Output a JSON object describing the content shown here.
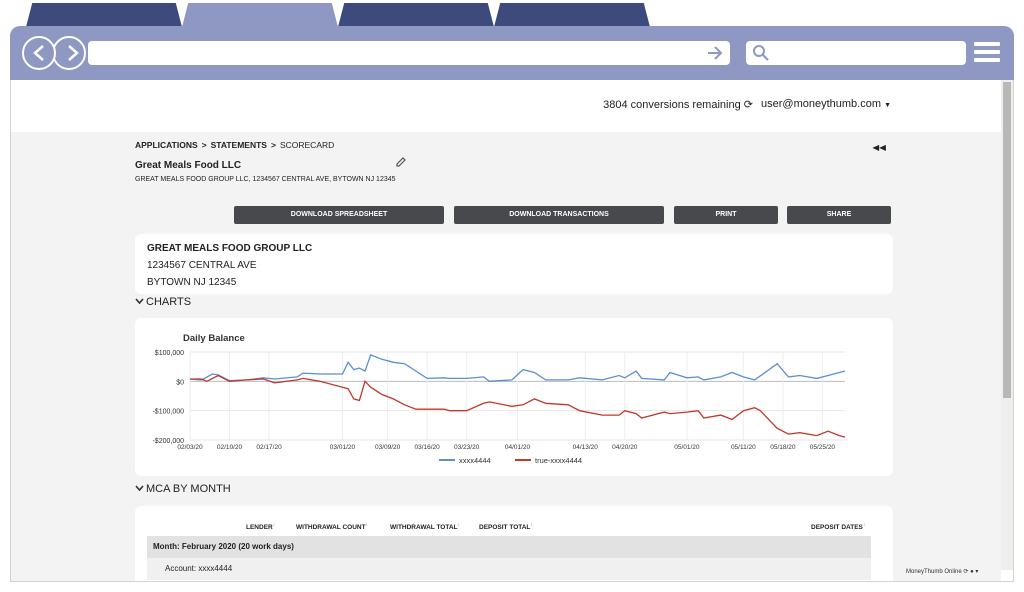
{
  "topbar": {
    "conversions": "3804 conversions remaining",
    "user": "user@moneythumb.com"
  },
  "breadcrumb": {
    "applications": "APPLICATIONS",
    "statements": "STATEMENTS",
    "scorecard": "SCORECARD"
  },
  "company": {
    "name": "Great Meals Food LLC",
    "subtitle": "GREAT MEALS FOOD GROUP LLC, 1234567 CENTRAL AVE, BYTOWN NJ 12345"
  },
  "buttons": {
    "download_spreadsheet": "DOWNLOAD SPREADSHEET",
    "download_transactions": "DOWNLOAD TRANSACTIONS",
    "print": "PRINT",
    "share": "SHARE"
  },
  "address": {
    "line1": "GREAT MEALS FOOD GROUP LLC",
    "line2": "1234567 CENTRAL AVE",
    "line3": "BYTOWN NJ 12345"
  },
  "sections": {
    "charts": "CHARTS",
    "mca": "MCA BY MONTH"
  },
  "chart_data": {
    "type": "line",
    "title": "Daily Balance",
    "xlabel": "",
    "ylabel": "",
    "ylim": [
      -200000,
      100000
    ],
    "yticks": [
      {
        "value": 100000,
        "label": "$100,000"
      },
      {
        "value": 0,
        "label": "$0"
      },
      {
        "value": -100000,
        "label": "-$100,000"
      },
      {
        "value": -200000,
        "label": "-$200,000"
      }
    ],
    "xticks": [
      "02/03/20",
      "02/10/20",
      "02/17/20",
      "03/01/20",
      "03/09/20",
      "03/16/20",
      "03/23/20",
      "04/01/20",
      "04/13/20",
      "04/20/20",
      "05/01/20",
      "05/11/20",
      "05/18/20",
      "05/25/20"
    ],
    "xtick_days": [
      0,
      7,
      14,
      27,
      35,
      42,
      49,
      58,
      70,
      77,
      88,
      98,
      105,
      112
    ],
    "xlim_days": [
      0,
      116
    ],
    "grid": true,
    "legend": "bottom",
    "series": [
      {
        "name": "xxxx4444",
        "color": "#5b8fd0",
        "days": [
          0,
          2,
          4,
          5,
          7,
          10,
          13,
          15,
          19,
          20,
          23,
          27,
          28,
          29,
          30,
          31,
          32,
          34,
          36,
          38,
          42,
          45,
          46,
          49,
          52,
          53,
          57,
          59,
          61,
          63,
          67,
          69,
          73,
          76,
          77,
          79,
          80,
          84,
          85,
          88,
          90,
          91,
          94,
          96,
          98,
          100,
          104,
          106,
          108,
          111,
          113,
          115,
          116
        ],
        "values": [
          8000,
          5000,
          25000,
          22000,
          2000,
          5000,
          12000,
          8000,
          15000,
          28000,
          25000,
          25000,
          65000,
          40000,
          45000,
          35000,
          90000,
          75000,
          65000,
          60000,
          10000,
          12000,
          10000,
          10000,
          15000,
          0,
          5000,
          40000,
          30000,
          5000,
          5000,
          12000,
          5000,
          20000,
          12000,
          35000,
          10000,
          5000,
          30000,
          12000,
          15000,
          5000,
          15000,
          30000,
          15000,
          5000,
          60000,
          15000,
          20000,
          10000,
          20000,
          30000,
          35000
        ]
      },
      {
        "name": "true-xxxx4444",
        "color": "#c0392b",
        "days": [
          0,
          2,
          3,
          5,
          7,
          10,
          13,
          15,
          19,
          20,
          23,
          27,
          28,
          29,
          30,
          31,
          32,
          34,
          36,
          38,
          40,
          45,
          46,
          49,
          52,
          53,
          57,
          59,
          61,
          63,
          67,
          69,
          73,
          76,
          77,
          79,
          80,
          84,
          85,
          88,
          90,
          91,
          94,
          96,
          98,
          100,
          101,
          104,
          106,
          108,
          111,
          113,
          115,
          116
        ],
        "values": [
          8000,
          8000,
          0,
          20000,
          0,
          5000,
          8000,
          -5000,
          5000,
          10000,
          0,
          -20000,
          -25000,
          -60000,
          -65000,
          0,
          -20000,
          -45000,
          -60000,
          -80000,
          -95000,
          -95000,
          -100000,
          -100000,
          -75000,
          -70000,
          -85000,
          -80000,
          -60000,
          -75000,
          -80000,
          -100000,
          -115000,
          -115000,
          -100000,
          -110000,
          -125000,
          -105000,
          -110000,
          -105000,
          -100000,
          -125000,
          -115000,
          -130000,
          -100000,
          -90000,
          -100000,
          -160000,
          -180000,
          -175000,
          -185000,
          -170000,
          -185000,
          -190000,
          -185000
        ]
      }
    ]
  },
  "mca": {
    "columns": [
      "LENDER",
      "WITHDRAWAL COUNT",
      "WITHDRAWAL TOTAL",
      "DEPOSIT TOTAL",
      "DEPOSIT DATES"
    ],
    "month": "Month: February 2020 (20 work days)",
    "account": "Account: xxxx4444"
  },
  "statusbar": "MoneyThumb Online"
}
